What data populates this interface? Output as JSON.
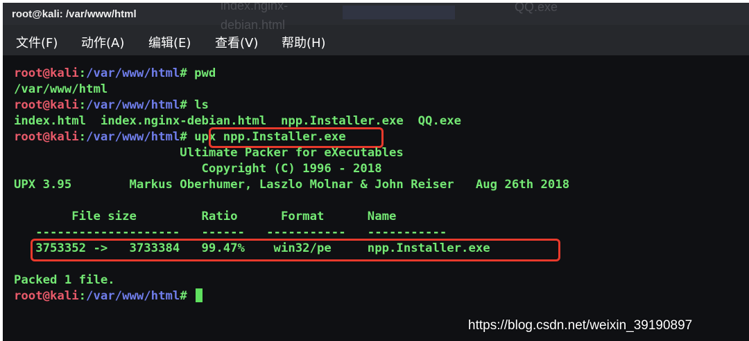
{
  "window": {
    "title": "root@kali: /var/www/html",
    "ghost_labels": [
      "index.nginx-",
      "debian.html",
      "QQ.exe"
    ]
  },
  "menu": [
    "文件(F)",
    "动作(A)",
    "编辑(E)",
    "查看(V)",
    "帮助(H)"
  ],
  "prompt": {
    "user": "root@kali",
    "sep": ":",
    "path": "/var/www/html",
    "suffix": "# "
  },
  "terminal": {
    "cmd1": "pwd",
    "out1": "/var/www/html",
    "cmd2": "ls",
    "out2": "index.html  index.nginx-debian.html  npp.Installer.exe  QQ.exe",
    "cmd3": "upx npp.Installer.exe",
    "banner1": "                       Ultimate Packer for eXecutables",
    "banner2": "                          Copyright (C) 1996 - 2018",
    "banner3": "UPX 3.95        Markus Oberhumer, Laszlo Molnar & John Reiser   Aug 26th 2018",
    "header": "        File size         Ratio      Format      Name",
    "dashes": "   --------------------   ------   -----------   -----------",
    "row": "   3753352 ->   3733384   99.47%    win32/pe     npp.Installer.exe",
    "packed": "Packed 1 file."
  },
  "watermark": "https://blog.csdn.net/weixin_39190897",
  "colors": {
    "terminal_bg": "#0f1013",
    "output_green": "#74e874",
    "prompt_red": "#e85a6a",
    "prompt_blue": "#6f7dea",
    "highlight_red": "#e83a2c"
  }
}
